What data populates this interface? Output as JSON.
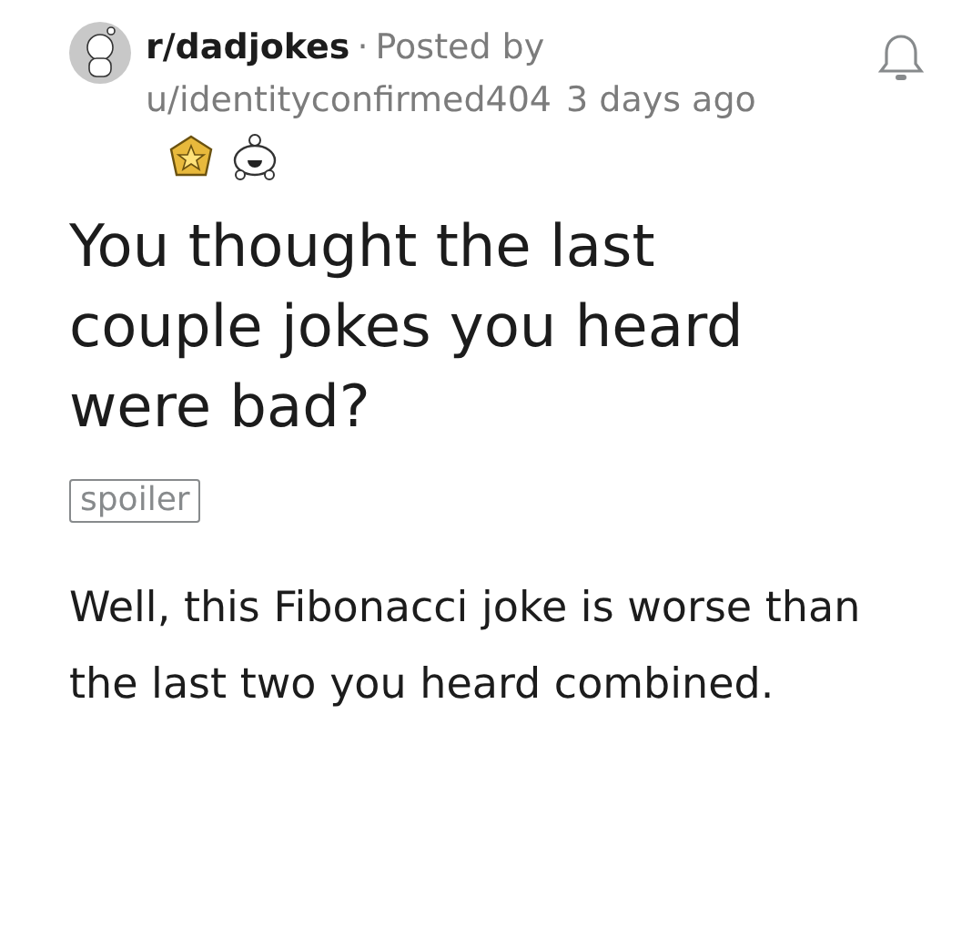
{
  "post": {
    "subreddit": "r/dadjokes",
    "separator": "·",
    "posted_by": "Posted by",
    "author": "u/identityconfirmed404",
    "time": "3 days ago",
    "title": "You thought the last couple jokes you heard were bad?",
    "tag": "spoiler",
    "body": "Well, this Fibonacci joke is worse than the last two you heard combined."
  }
}
